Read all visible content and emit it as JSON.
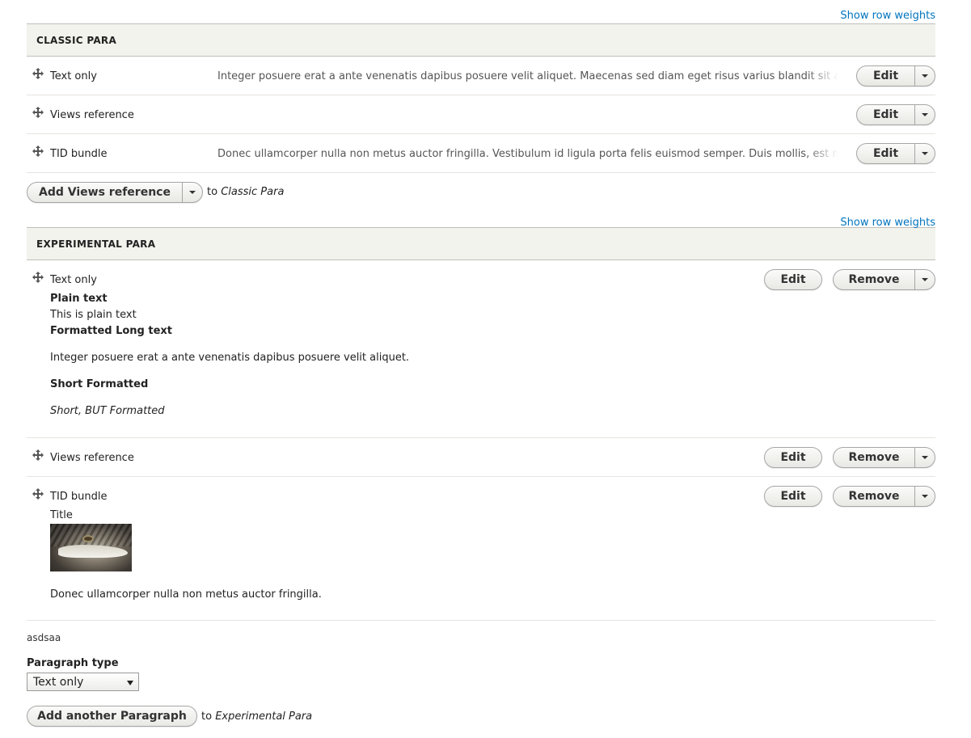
{
  "classic": {
    "show_row_weights": "Show row weights",
    "header": "CLASSIC PARA",
    "rows": [
      {
        "label": "Text only",
        "summary": "Integer posuere erat a ante venenatis dapibus posuere velit aliquet. Maecenas sed diam eget risus varius blandit sit amet non magna.",
        "edit": "Edit"
      },
      {
        "label": "Views reference",
        "summary": "",
        "edit": "Edit"
      },
      {
        "label": "TID bundle",
        "summary": "Donec ullamcorper nulla non metus auctor fringilla. Vestibulum id ligula porta felis euismod semper. Duis mollis, est non commodo luctus.",
        "edit": "Edit"
      }
    ],
    "add_button": "Add Views reference",
    "add_to_prefix": "to",
    "add_to_target": "Classic Para"
  },
  "experimental": {
    "show_row_weights": "Show row weights",
    "header": "EXPERIMENTAL PARA",
    "rows": [
      {
        "label": "Text only",
        "edit": "Edit",
        "remove": "Remove",
        "plain_text_label": "Plain text",
        "plain_text_value": "This is plain text",
        "formatted_long_label": "Formatted Long text",
        "formatted_long_value": "Integer posuere erat a ante venenatis dapibus posuere velit aliquet.",
        "short_formatted_label": "Short Formatted",
        "short_formatted_value": "Short, BUT Formatted"
      },
      {
        "label": "Views reference",
        "edit": "Edit",
        "remove": "Remove"
      },
      {
        "label": "TID bundle",
        "edit": "Edit",
        "remove": "Remove",
        "title": "Title",
        "body": "Donec ullamcorper nulla non metus auctor fringilla."
      }
    ]
  },
  "footer": {
    "note": "asdsaa",
    "paragraph_type_label": "Paragraph type",
    "paragraph_type_selected": "Text only",
    "add_another": "Add another Paragraph",
    "add_to_prefix": "to",
    "add_to_target": "Experimental Para"
  },
  "colors": {
    "link": "#0074bd",
    "header_bg": "#f3f3ee"
  }
}
